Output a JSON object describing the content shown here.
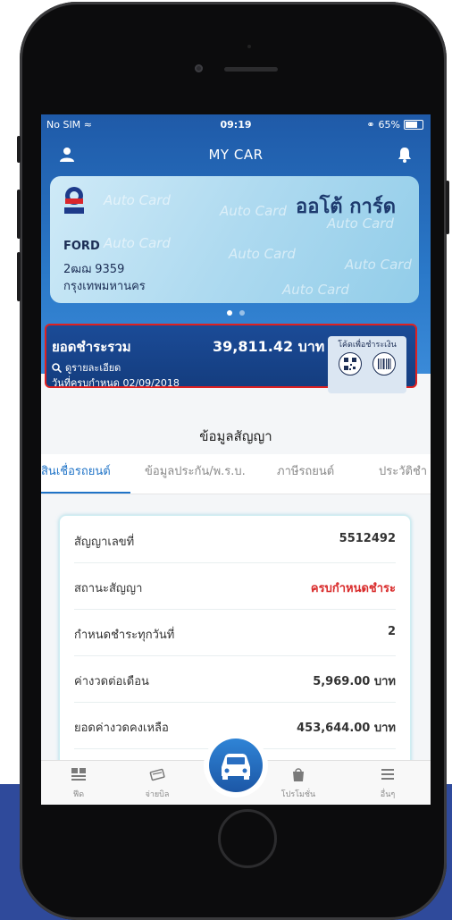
{
  "status": {
    "carrier": "No SIM",
    "time": "09:19",
    "battery": "65%"
  },
  "nav": {
    "title": "MY CAR"
  },
  "card": {
    "brand_text": "ออโต้ การ์ด",
    "watermark": "Auto Card",
    "make": "FORD",
    "plate": "2ฒฌ 9359",
    "province": "กรุงเทพมหานคร"
  },
  "payment": {
    "label": "ยอดชำระรวม",
    "amount": "39,811.42 บาท",
    "detail_link": "ดูรายละเอียด",
    "due_text": "วันที่ครบกำหนด 02/09/2018",
    "code_label": "โค้ดเพื่อชำระเงิน"
  },
  "section": {
    "title": "ข้อมูลสัญญา"
  },
  "tabs": [
    "สินเชื่อรถยนต์",
    "ข้อมูลประกัน/พ.ร.บ.",
    "ภาษีรถยนต์",
    "ประวัติชำ"
  ],
  "contract": {
    "rows": [
      {
        "label": "สัญญาเลขที่",
        "value": "5512492"
      },
      {
        "label": "สถานะสัญญา",
        "value": "ครบกำหนดชำระ"
      },
      {
        "label": "กำหนดชำระทุกวันที่",
        "value": "2"
      },
      {
        "label": "ค่างวดต่อเดือน",
        "value": "5,969.00 บาท"
      },
      {
        "label": "ยอดค่างวดคงเหลือ",
        "value": "453,644.00 บาท"
      }
    ]
  },
  "tabbar": {
    "feed": "ฟีด",
    "pay": "จ่ายบิล",
    "promo": "โปรโมชั่น",
    "more": "อื่นๆ"
  },
  "colors": {
    "primary": "#1f5aa8",
    "accent": "#1f73c7",
    "status_red": "#d92b2b",
    "highlight_border": "#e02020"
  }
}
